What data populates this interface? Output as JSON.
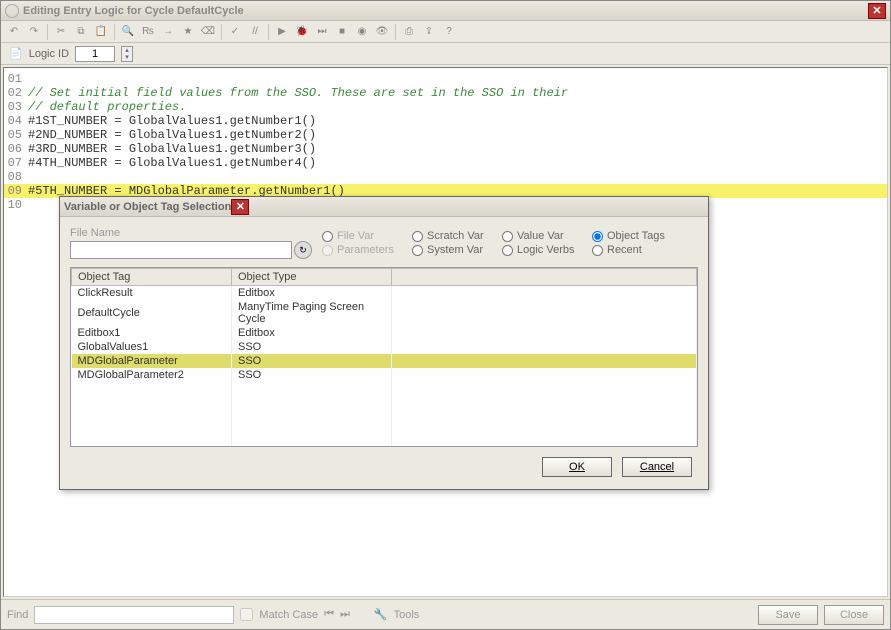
{
  "window": {
    "title": "Editing Entry Logic for Cycle DefaultCycle"
  },
  "logic_id": {
    "label": "Logic ID",
    "value": "1"
  },
  "code_lines": [
    {
      "n": "01",
      "cls": "code",
      "text": "",
      "hl": false
    },
    {
      "n": "02",
      "cls": "comment",
      "text": "// Set initial field values from the SSO. These are set in the SSO in their",
      "hl": false
    },
    {
      "n": "03",
      "cls": "comment",
      "text": "// default properties.",
      "hl": false
    },
    {
      "n": "04",
      "cls": "code",
      "text": "#1ST_NUMBER = GlobalValues1.getNumber1()",
      "hl": false
    },
    {
      "n": "05",
      "cls": "code",
      "text": "#2ND_NUMBER = GlobalValues1.getNumber2()",
      "hl": false
    },
    {
      "n": "06",
      "cls": "code",
      "text": "#3RD_NUMBER = GlobalValues1.getNumber3()",
      "hl": false
    },
    {
      "n": "07",
      "cls": "code",
      "text": "#4TH_NUMBER = GlobalValues1.getNumber4()",
      "hl": false
    },
    {
      "n": "08",
      "cls": "code",
      "text": "",
      "hl": false
    },
    {
      "n": "09",
      "cls": "code",
      "text": "#5TH_NUMBER = MDGlobalParameter.getNumber1()",
      "hl": true
    },
    {
      "n": "10",
      "cls": "code",
      "text": "",
      "hl": false
    }
  ],
  "dialog": {
    "title": "Variable or Object Tag Selection",
    "file_label": "File Name",
    "radios": {
      "c1a": "File Var",
      "c1b": "Parameters",
      "c2a": "Scratch Var",
      "c2b": "System Var",
      "c3a": "Value Var",
      "c3b": "Logic Verbs",
      "c4a": "Object Tags",
      "c4b": "Recent"
    },
    "columns": {
      "c1": "Object Tag",
      "c2": "Object Type"
    },
    "rows": [
      {
        "tag": "ClickResult",
        "type": "Editbox",
        "sel": false
      },
      {
        "tag": "DefaultCycle",
        "type": "ManyTime Paging Screen Cycle",
        "sel": false
      },
      {
        "tag": "Editbox1",
        "type": "Editbox",
        "sel": false
      },
      {
        "tag": "GlobalValues1",
        "type": "SSO",
        "sel": false
      },
      {
        "tag": "MDGlobalParameter",
        "type": "SSO",
        "sel": true
      },
      {
        "tag": "MDGlobalParameter2",
        "type": "SSO",
        "sel": false
      }
    ],
    "ok": "OK",
    "cancel": "Cancel"
  },
  "footer": {
    "find": "Find",
    "match": "Match Case",
    "tools": "Tools",
    "save": "Save",
    "close": "Close"
  }
}
